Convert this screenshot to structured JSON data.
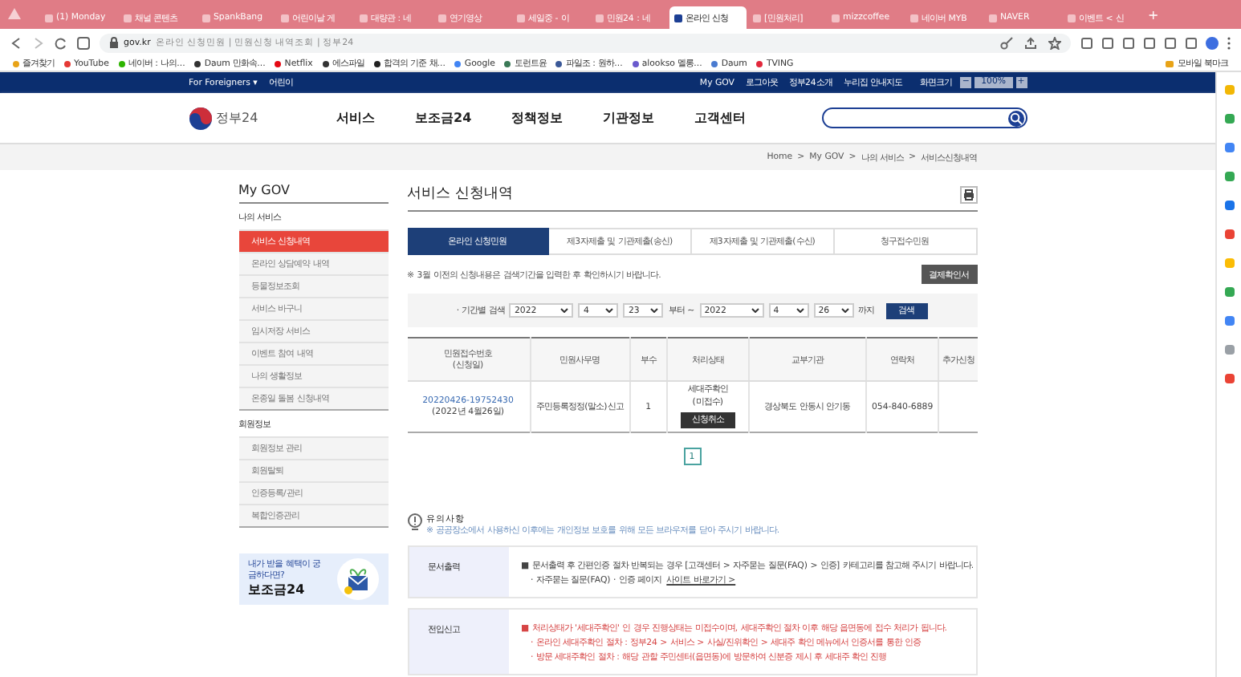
{
  "browser": {
    "tabs": [
      {
        "label": "(1) Monday",
        "selected": false
      },
      {
        "label": "채널 콘텐츠",
        "selected": false
      },
      {
        "label": "SpankBang",
        "selected": false
      },
      {
        "label": "어린이날 게",
        "selected": false
      },
      {
        "label": "대량관 : 네",
        "selected": false
      },
      {
        "label": "연기영상",
        "selected": false
      },
      {
        "label": "세일중 - 이",
        "selected": false
      },
      {
        "label": "민원24 : 네",
        "selected": false
      },
      {
        "label": "온라인 신청",
        "selected": true
      },
      {
        "label": "[민원처리]",
        "selected": false
      },
      {
        "label": "mizzcoffee",
        "selected": false
      },
      {
        "label": "네이버 MYB",
        "selected": false
      },
      {
        "label": "NAVER",
        "selected": false
      },
      {
        "label": "이벤트 < 신",
        "selected": false
      }
    ],
    "new_tab": "+",
    "address": {
      "domain": "gov.kr",
      "title": "온라인 신청민원 | 민원신청 내역조회 | 정부24"
    },
    "bookmarks": [
      {
        "label": "즐겨찾기",
        "color": "#e8a317"
      },
      {
        "label": "YouTube",
        "color": "#e53935"
      },
      {
        "label": "네이버 : 나의...",
        "color": "#2db400"
      },
      {
        "label": "Daum 만화속...",
        "color": "#333333"
      },
      {
        "label": "Netflix",
        "color": "#e50914"
      },
      {
        "label": "에스파일",
        "color": "#333333"
      },
      {
        "label": "합격의 기준 채...",
        "color": "#222222"
      },
      {
        "label": "Google",
        "color": "#4285f4"
      },
      {
        "label": "토런트윤",
        "color": "#3b7a57"
      },
      {
        "label": "파일조 : 원하...",
        "color": "#3b5998"
      },
      {
        "label": "alookso 멜롱...",
        "color": "#6a5acd"
      },
      {
        "label": "Daum",
        "color": "#4a7bd0"
      },
      {
        "label": "TVING",
        "color": "#e2283c"
      }
    ],
    "mobile_bookmarks": "모바일 북마크"
  },
  "site": {
    "utility_left": [
      {
        "label": "For Foreigners ▾"
      },
      {
        "label": "어린이"
      }
    ],
    "utility_right": [
      {
        "label": "My GOV"
      },
      {
        "label": "로그아웃"
      },
      {
        "label": "정부24소개"
      },
      {
        "label": "누리집 안내지도"
      }
    ],
    "screen_size": {
      "label": "화면크기",
      "minus": "−",
      "value": "100%",
      "plus": "+"
    },
    "logo": "정부24",
    "nav": [
      "서비스",
      "보조금24",
      "정책정보",
      "기관정보",
      "고객센터"
    ],
    "breadcrumb": [
      "Home",
      "My GOV",
      "나의 서비스",
      "서비스신청내역"
    ],
    "breadcrumb_separator": ">"
  },
  "sidebar": {
    "title": "My GOV",
    "groups": [
      {
        "heading": "나의 서비스",
        "items": [
          {
            "label": "서비스 신청내역",
            "selected": true
          },
          {
            "label": "온라인 상담예약 내역",
            "selected": false
          },
          {
            "label": "등물정보조회",
            "selected": false
          },
          {
            "label": "서비스 바구니",
            "selected": false
          },
          {
            "label": "임시저장 서비스",
            "selected": false
          },
          {
            "label": "이벤트 참여 내역",
            "selected": false
          },
          {
            "label": "나의 생활정보",
            "selected": false
          },
          {
            "label": "온종일 돌봄 신청내역",
            "selected": false
          }
        ]
      },
      {
        "heading": "회원정보",
        "items": [
          {
            "label": "회원정보 관리",
            "selected": false
          },
          {
            "label": "회원탈퇴",
            "selected": false
          },
          {
            "label": "인증등록/관리",
            "selected": false
          },
          {
            "label": "복합인증관리",
            "selected": false
          }
        ]
      }
    ],
    "banner": {
      "text": "내가 받을 혜택이 궁금하다면?",
      "title": "보조금24"
    }
  },
  "main": {
    "title": "서비스 신청내역",
    "tabs": [
      {
        "label": "온라인 신청민원",
        "selected": true
      },
      {
        "label": "제3자제출 및 기관제출(송신)",
        "selected": false
      },
      {
        "label": "제3자제출 및 기관제출(수신)",
        "selected": false
      },
      {
        "label": "청구접수민원",
        "selected": false
      }
    ],
    "note": "※ 3월 이전의 신청내용은 검색기간을 입력한 후 확인하시기 바랍니다.",
    "receipt_button": "결제확인서",
    "search": {
      "label": "· 기간별 검색",
      "from": {
        "year": "2022",
        "month": "4",
        "day": "23"
      },
      "from_suffix": "부터 ~",
      "to": {
        "year": "2022",
        "month": "4",
        "day": "26"
      },
      "to_suffix": "까지",
      "button": "검색"
    },
    "table": {
      "columns": [
        "민원접수번호\n(신청일)",
        "민원사무명",
        "부수",
        "처리상태",
        "교부기관",
        "연락처",
        "추가신청"
      ],
      "rows": [
        {
          "number": "20220426-19752430",
          "date": "(2022년 4월26일)",
          "name": "주민등록정정(말소)신고",
          "copies": "1",
          "status": "세대주확인\n(미접수)",
          "cancel_button": "신청취소",
          "agency": "경상북도 안동시 안기동",
          "phone": "054-840-6889"
        }
      ]
    },
    "pages": [
      {
        "label": "1",
        "selected": true
      }
    ],
    "caution": {
      "title": "유의사항",
      "text": "※ 공공장소에서 사용하신 이후에는 개인정보 보호를 위해 모든 브라우저를 닫아 주시기 바랍니다."
    },
    "notices": [
      {
        "heading": "문서출력",
        "lines": [
          {
            "kind": "main",
            "text": "■ 문서출력 후 간편인증 절차 반복되는 경우 [고객센터 > 자주묻는 질문(FAQ) > 인증] 카테고리를 참고해 주시기 바랍니다."
          },
          {
            "kind": "sub",
            "text": "· 자주묻는 질문(FAQ) · 인증 페이지",
            "link": "사이트 바로가기 >"
          }
        ]
      },
      {
        "heading": "전입신고",
        "lines": [
          {
            "kind": "alert",
            "text": "■ 처리상태가 '세대주확인' 인 경우 진행상태는 미접수이며, 세대주확인 절차 이후 해당 읍면동에 접수 처리가 됩니다."
          },
          {
            "kind": "alert-sub",
            "text": "· 온라인 세대주확인 절차 : 정부24 > 서비스 > 사실/진위확인 > 세대주 확인 메뉴에서 인증서를 통한 인증"
          },
          {
            "kind": "alert-sub",
            "text": "· 방문 세대주확인 절차 : 해당 관할 주민센터(읍면동)에 방문하여 신분증 제시 후 세대주 확인 진행"
          }
        ]
      }
    ]
  },
  "extensions": [
    {
      "color": "#f2b705"
    },
    {
      "color": "#34a853"
    },
    {
      "color": "#4285f4"
    },
    {
      "color": "#34a853"
    },
    {
      "color": "#1a73e8"
    },
    {
      "color": "#ea4335"
    },
    {
      "color": "#fbbc05"
    },
    {
      "color": "#34a853"
    },
    {
      "color": "#4285f4"
    },
    {
      "color": "#9aa0a6"
    },
    {
      "color": "#ea4335"
    }
  ]
}
